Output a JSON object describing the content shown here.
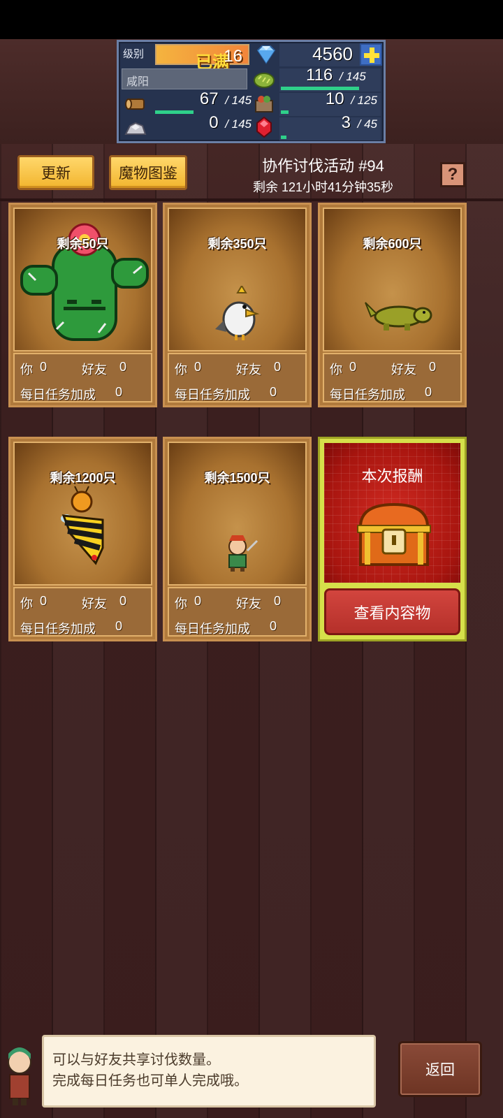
{
  "stats": {
    "level_label": "级别",
    "level_max": "已满",
    "level": "16",
    "gems": "4560",
    "city": "咸阳",
    "crop_current": "116",
    "crop_max": "/ 145",
    "crop_progress": 0.8,
    "wood_current": "67",
    "wood_max": "/ 145",
    "wood_progress": 0.46,
    "food_current": "10",
    "food_max": "/ 125",
    "food_progress": 0.08,
    "ore_current": "0",
    "ore_max": "/ 145",
    "ruby_current": "3",
    "ruby_max": "/ 45",
    "ruby_progress": 0.06
  },
  "header": {
    "refresh_label": "更新",
    "bestiary_label": "魔物图鉴",
    "event_title": "协作讨伐活动 #94",
    "event_time": "剩余 121小时41分钟35秒",
    "help_label": "?"
  },
  "cards": [
    {
      "remaining": "剩余50只",
      "you_label": "你",
      "you": "0",
      "friends_label": "好友",
      "friends": "0",
      "bonus_label": "每日任务加成",
      "bonus": "0",
      "monster": "cactus"
    },
    {
      "remaining": "剩余350只",
      "you_label": "你",
      "you": "0",
      "friends_label": "好友",
      "friends": "0",
      "bonus_label": "每日任务加成",
      "bonus": "0",
      "monster": "bird"
    },
    {
      "remaining": "剩余600只",
      "you_label": "你",
      "you": "0",
      "friends_label": "好友",
      "friends": "0",
      "bonus_label": "每日任务加成",
      "bonus": "0",
      "monster": "lizard"
    },
    {
      "remaining": "剩余1200只",
      "you_label": "你",
      "you": "0",
      "friends_label": "好友",
      "friends": "0",
      "bonus_label": "每日任务加成",
      "bonus": "0",
      "monster": "bee"
    },
    {
      "remaining": "剩余1500只",
      "you_label": "你",
      "you": "0",
      "friends_label": "好友",
      "friends": "0",
      "bonus_label": "每日任务加成",
      "bonus": "0",
      "monster": "bandit"
    }
  ],
  "reward": {
    "title": "本次报酬",
    "button": "查看内容物"
  },
  "tip": {
    "line1": "可以与好友共享讨伐数量。",
    "line2": "完成每日任务也可单人完成哦。"
  },
  "back_label": "返回"
}
